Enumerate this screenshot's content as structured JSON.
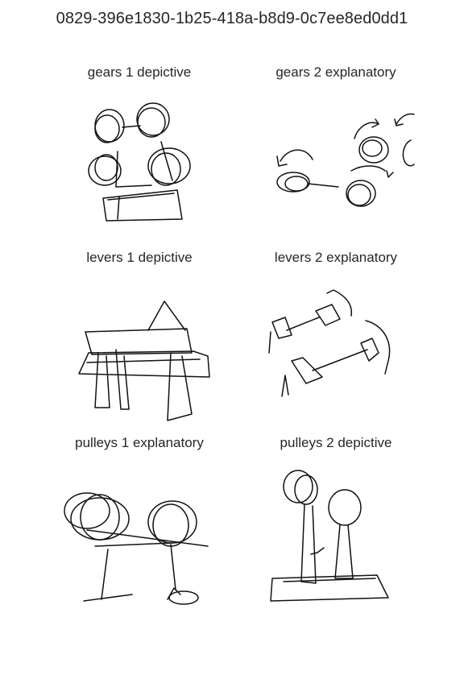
{
  "page": {
    "title": "0829-396e1830-1b25-418a-b8d9-0c7ee8ed0dd1"
  },
  "sketches": [
    {
      "label": "gears 1 depictive"
    },
    {
      "label": "gears 2 explanatory"
    },
    {
      "label": "levers 1 depictive"
    },
    {
      "label": "levers 2 explanatory"
    },
    {
      "label": "pulleys 1 explanatory"
    },
    {
      "label": "pulleys 2 depictive"
    }
  ]
}
